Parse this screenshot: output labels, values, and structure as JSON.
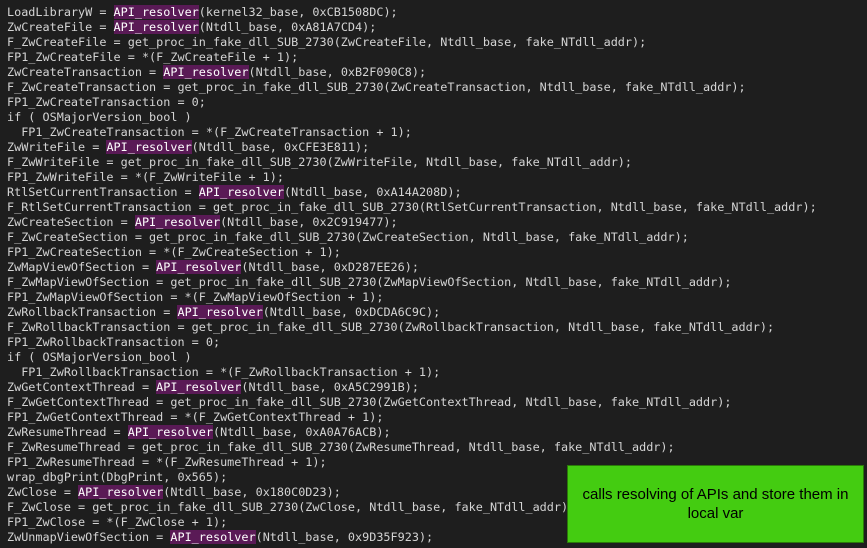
{
  "colors": {
    "background": "#1e1e1e",
    "text": "#d4d4d4",
    "highlight": "#5a1a56",
    "annotation": "#44cc11"
  },
  "code_lines": [
    "LoadLibraryW = API_resolver(kernel32_base, 0xCB1508DC);",
    "ZwCreateFile = API_resolver(Ntdll_base, 0xA81A7CD4);",
    "F_ZwCreateFile = get_proc_in_fake_dll_SUB_2730(ZwCreateFile, Ntdll_base, fake_NTdll_addr);",
    "FP1_ZwCreateFile = *(F_ZwCreateFile + 1);",
    "ZwCreateTransaction = API_resolver(Ntdll_base, 0xB2F090C8);",
    "F_ZwCreateTransaction = get_proc_in_fake_dll_SUB_2730(ZwCreateTransaction, Ntdll_base, fake_NTdll_addr);",
    "FP1_ZwCreateTransaction = 0;",
    "if ( OSMajorVersion_bool )",
    "  FP1_ZwCreateTransaction = *(F_ZwCreateTransaction + 1);",
    "ZwWriteFile = API_resolver(Ntdll_base, 0xCFE3E811);",
    "F_ZwWriteFile = get_proc_in_fake_dll_SUB_2730(ZwWriteFile, Ntdll_base, fake_NTdll_addr);",
    "FP1_ZwWriteFile = *(F_ZwWriteFile + 1);",
    "RtlSetCurrentTransaction = API_resolver(Ntdll_base, 0xA14A208D);",
    "F_RtlSetCurrentTransaction = get_proc_in_fake_dll_SUB_2730(RtlSetCurrentTransaction, Ntdll_base, fake_NTdll_addr);",
    "ZwCreateSection = API_resolver(Ntdll_base, 0x2C919477);",
    "F_ZwCreateSection = get_proc_in_fake_dll_SUB_2730(ZwCreateSection, Ntdll_base, fake_NTdll_addr);",
    "FP1_ZwCreateSection = *(F_ZwCreateSection + 1);",
    "ZwMapViewOfSection = API_resolver(Ntdll_base, 0xD287EE26);",
    "F_ZwMapViewOfSection = get_proc_in_fake_dll_SUB_2730(ZwMapViewOfSection, Ntdll_base, fake_NTdll_addr);",
    "FP1_ZwMapViewOfSection = *(F_ZwMapViewOfSection + 1);",
    "ZwRollbackTransaction = API_resolver(Ntdll_base, 0xDCDA6C9C);",
    "F_ZwRollbackTransaction = get_proc_in_fake_dll_SUB_2730(ZwRollbackTransaction, Ntdll_base, fake_NTdll_addr);",
    "FP1_ZwRollbackTransaction = 0;",
    "if ( OSMajorVersion_bool )",
    "  FP1_ZwRollbackTransaction = *(F_ZwRollbackTransaction + 1);",
    "ZwGetContextThread = API_resolver(Ntdll_base, 0xA5C2991B);",
    "F_ZwGetContextThread = get_proc_in_fake_dll_SUB_2730(ZwGetContextThread, Ntdll_base, fake_NTdll_addr);",
    "FP1_ZwGetContextThread = *(F_ZwGetContextThread + 1);",
    "ZwResumeThread = API_resolver(Ntdll_base, 0xA0A76ACB);",
    "F_ZwResumeThread = get_proc_in_fake_dll_SUB_2730(ZwResumeThread, Ntdll_base, fake_NTdll_addr);",
    "FP1_ZwResumeThread = *(F_ZwResumeThread + 1);",
    "wrap_dbgPrint(DbgPrint, 0x565);",
    "ZwClose = API_resolver(Ntdll_base, 0x180C0D23);",
    "F_ZwClose = get_proc_in_fake_dll_SUB_2730(ZwClose, Ntdll_base, fake_NTdll_addr);",
    "FP1_ZwClose = *(F_ZwClose + 1);",
    "ZwUnmapViewOfSection = API_resolver(Ntdll_base, 0x9D35F923);"
  ],
  "annotation": {
    "text": "calls resolving of APIs and store them in local var"
  }
}
